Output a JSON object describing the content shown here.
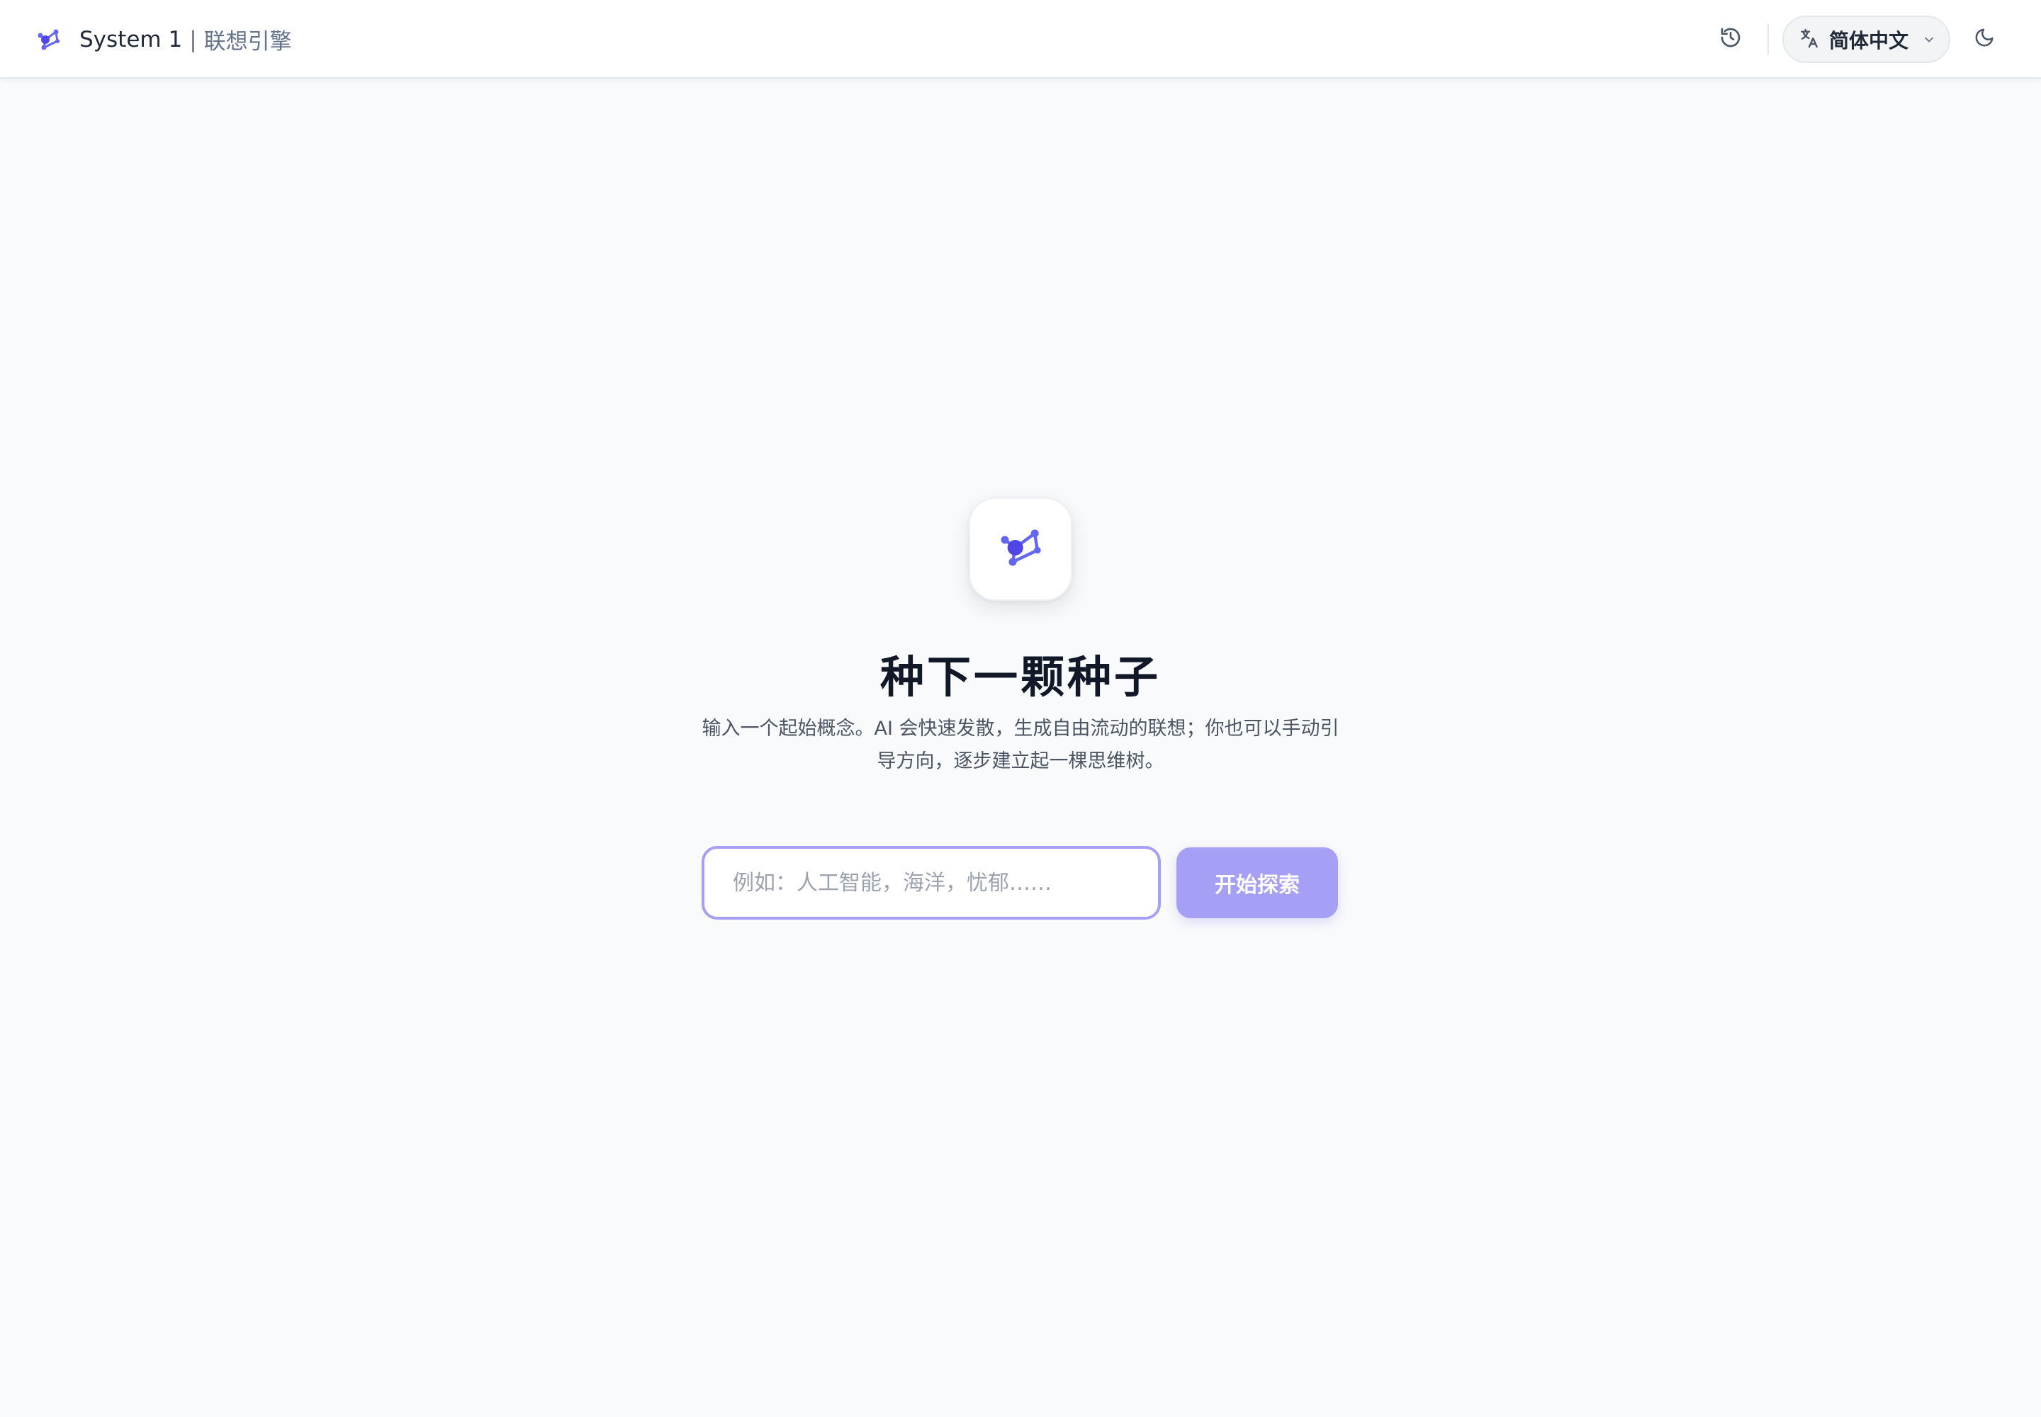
{
  "header": {
    "app_name": "System 1",
    "separator": "|",
    "subtitle": "联想引擎",
    "logo_icon": "network-nodes-icon",
    "history_icon": "history-icon",
    "language": {
      "icon": "translate-icon",
      "selected": "简体中文",
      "chevron_icon": "chevron-down-icon"
    },
    "theme_icon": "moon-icon"
  },
  "hero": {
    "icon": "network-nodes-icon",
    "title": "种下一颗种子",
    "description": "输入一个起始概念。AI 会快速发散，生成自由流动的联想；你也可以手动引导方向，逐步建立起一棵思维树。"
  },
  "seed_form": {
    "placeholder": "例如：人工智能，海洋，忧郁……",
    "value": "",
    "submit_label": "开始探索"
  },
  "colors": {
    "accent": "#6366f1",
    "accent_soft": "#a5a0f5",
    "background": "#f9fafb",
    "text_primary": "#111827",
    "text_secondary": "#4b5563"
  }
}
